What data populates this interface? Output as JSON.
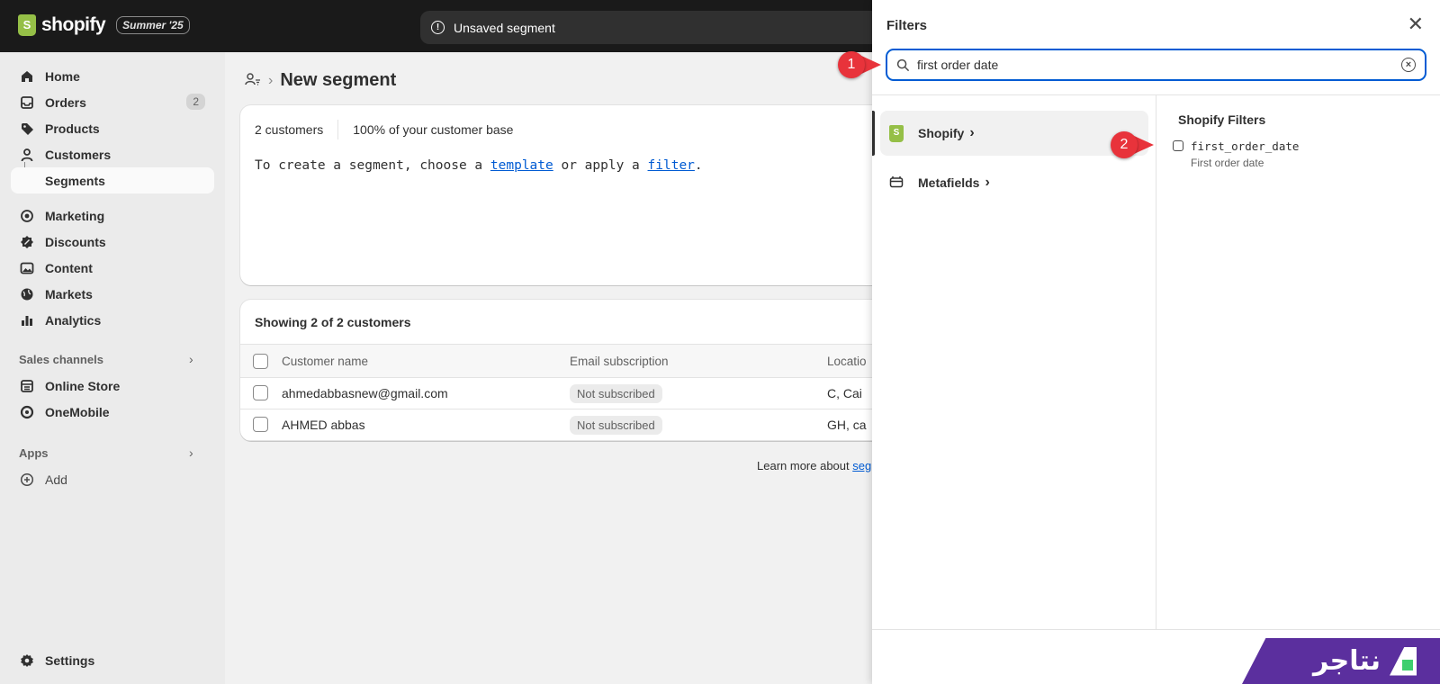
{
  "topbar": {
    "brand": "shopify",
    "edition": "Summer '25",
    "unsaved_label": "Unsaved segment"
  },
  "sidebar": {
    "items": [
      {
        "label": "Home",
        "icon": "home-icon"
      },
      {
        "label": "Orders",
        "icon": "inbox-icon",
        "badge": "2"
      },
      {
        "label": "Products",
        "icon": "tag-icon"
      },
      {
        "label": "Customers",
        "icon": "person-icon"
      },
      {
        "label": "Segments",
        "icon": "",
        "active": true
      },
      {
        "label": "Marketing",
        "icon": "target-icon"
      },
      {
        "label": "Discounts",
        "icon": "discount-icon"
      },
      {
        "label": "Content",
        "icon": "image-icon"
      },
      {
        "label": "Markets",
        "icon": "globe-icon"
      },
      {
        "label": "Analytics",
        "icon": "bar-chart-icon"
      }
    ],
    "sales_channels_label": "Sales channels",
    "channels": [
      {
        "label": "Online Store",
        "icon": "store-icon"
      },
      {
        "label": "OneMobile",
        "icon": "app-icon"
      }
    ],
    "apps_label": "Apps",
    "add_label": "Add",
    "settings_label": "Settings"
  },
  "main": {
    "title": "New segment",
    "customer_count": "2 customers",
    "customer_base": "100% of your customer base",
    "code_prefix": "To create a segment, choose a",
    "code_template": "template",
    "code_mid": "or apply a",
    "code_filter": "filter",
    "code_suffix": ".",
    "showing": "Showing 2 of 2 customers",
    "columns": [
      "Customer name",
      "Email subscription",
      "Locatio"
    ],
    "rows": [
      {
        "name": "ahmedabbasnew@gmail.com",
        "subscription": "Not subscribed",
        "location": "C, Cai"
      },
      {
        "name": "AHMED abbas",
        "subscription": "Not subscribed",
        "location": "GH, ca"
      }
    ],
    "learn_more": "Learn more about",
    "learn_link": "seg"
  },
  "filters": {
    "title": "Filters",
    "search_value": "first order date",
    "categories": [
      {
        "label": "Shopify",
        "icon": "shopify-bag-icon",
        "active": true
      },
      {
        "label": "Metafields",
        "icon": "metafield-icon"
      }
    ],
    "section_title": "Shopify Filters",
    "results": [
      {
        "code": "first_order_date",
        "description": "First order date"
      }
    ]
  },
  "callouts": [
    "1",
    "2"
  ],
  "brand_badge": "نتاجر",
  "colors": {
    "accent": "#005bd3",
    "callout": "#e8333b",
    "shopify_green": "#95bf47",
    "brand_purple": "#5b2f9e"
  }
}
